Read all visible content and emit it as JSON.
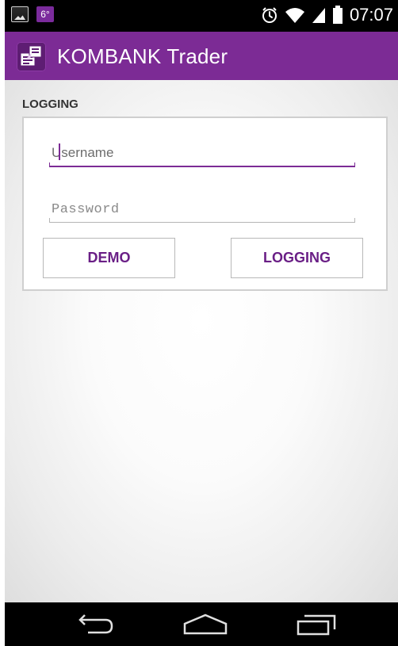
{
  "status_bar": {
    "left_icons": [
      "photo-icon"
    ],
    "temperature": "6°",
    "right_icons": [
      "alarm-icon",
      "wifi-icon",
      "signal-icon",
      "battery-icon"
    ],
    "time": "07:07"
  },
  "app_bar": {
    "title": "KOMBANK Trader",
    "icon": "app-logo-icon",
    "color": "#7c2b95"
  },
  "login": {
    "section_label": "LOGGING",
    "username": {
      "value": "",
      "placeholder": "Username",
      "focused": true
    },
    "password": {
      "value": "",
      "placeholder": "Password"
    },
    "demo_button": "DEMO",
    "login_button": "LOGGING"
  },
  "nav_bar": {
    "buttons": [
      "back-icon",
      "home-icon",
      "recent-apps-icon"
    ]
  },
  "colors": {
    "accent": "#7c2b95",
    "button_text": "#6a1f86",
    "status_badge": "#7b2b9c"
  }
}
